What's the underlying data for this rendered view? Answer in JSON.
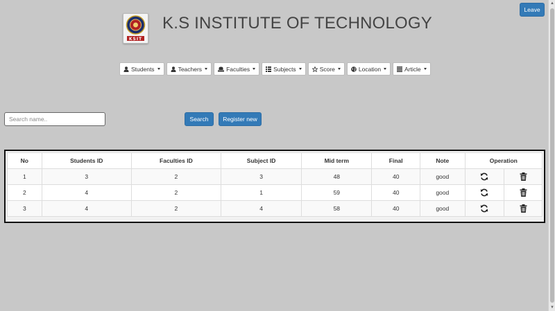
{
  "header": {
    "title": "K.S INSTITUTE OF TECHNOLOGY",
    "logo_text": "KSIT",
    "leave_label": "Leave"
  },
  "nav": [
    {
      "label": "Students",
      "icon": "user-icon"
    },
    {
      "label": "Teachers",
      "icon": "user-icon"
    },
    {
      "label": "Faculties",
      "icon": "hat-icon"
    },
    {
      "label": "Subjects",
      "icon": "list-icon"
    },
    {
      "label": "Score",
      "icon": "star-icon"
    },
    {
      "label": "Location",
      "icon": "globe-icon"
    },
    {
      "label": "Article",
      "icon": "align-icon"
    }
  ],
  "search": {
    "placeholder": "Search name..",
    "value": "",
    "search_label": "Search",
    "register_label": "Register new"
  },
  "table": {
    "headers": [
      "No",
      "Students ID",
      "Faculties ID",
      "Subject ID",
      "Mid term",
      "Final",
      "Note",
      "Operation"
    ],
    "rows": [
      {
        "no": "1",
        "student_id": "3",
        "faculty_id": "2",
        "subject_id": "3",
        "mid_term": "48",
        "final": "40",
        "note": "good"
      },
      {
        "no": "2",
        "student_id": "4",
        "faculty_id": "2",
        "subject_id": "1",
        "mid_term": "59",
        "final": "40",
        "note": "good"
      },
      {
        "no": "3",
        "student_id": "4",
        "faculty_id": "2",
        "subject_id": "4",
        "mid_term": "58",
        "final": "40",
        "note": "good"
      }
    ],
    "operation_icons": [
      "refresh-icon",
      "trash-icon"
    ]
  },
  "colors": {
    "background": "#c8c8c8",
    "primary": "#337ab7",
    "table_border": "#111111"
  }
}
